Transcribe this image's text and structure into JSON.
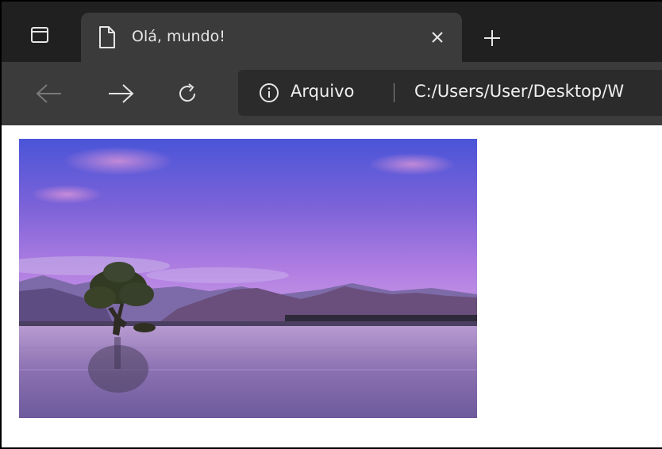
{
  "window": {
    "tab": {
      "title": "Olá, mundo!",
      "icon": "page-icon"
    },
    "tab_actions_icon": "tab-actions-icon",
    "close_icon": "close-icon",
    "new_tab_icon": "plus-icon"
  },
  "toolbar": {
    "back_icon": "arrow-left-icon",
    "forward_icon": "arrow-right-icon",
    "refresh_icon": "refresh-icon",
    "address": {
      "info_icon": "info-icon",
      "security_label": "Arquivo",
      "url": "C:/Users/User/Desktop/W"
    }
  },
  "page": {
    "image": {
      "subject": "lake-landscape-photo"
    }
  },
  "colors": {
    "tabstrip_bg": "#202020",
    "active_tab_bg": "#3b3b3b",
    "toolbar_bg": "#3b3b3b",
    "address_bg": "#2b2b2b",
    "text": "#f0f0f0",
    "page_bg": "#ffffff"
  }
}
